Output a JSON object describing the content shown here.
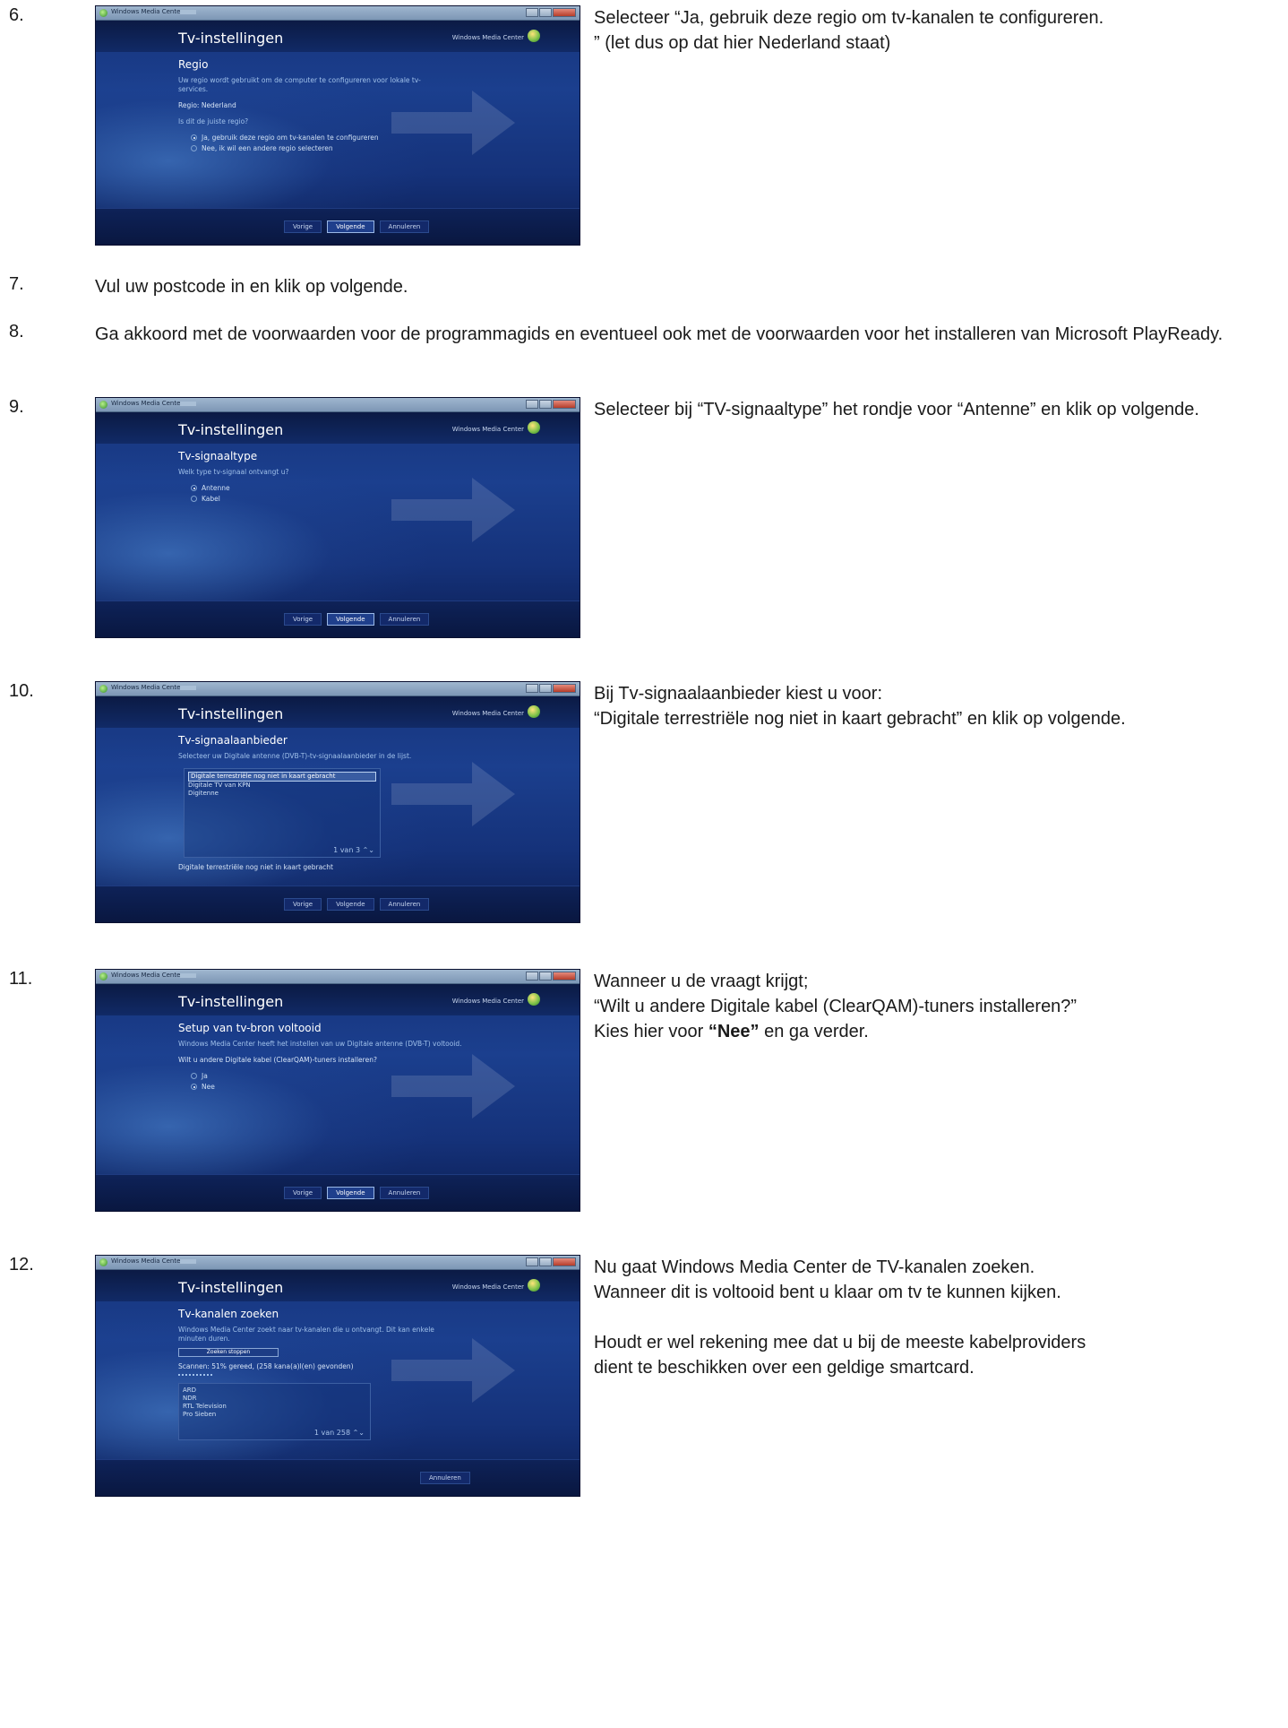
{
  "window_common": {
    "app_title": "Windows Media Center",
    "header_title": "Tv-instellingen",
    "brand": "Windows Media Center",
    "buttons": {
      "prev": "Vorige",
      "next": "Volgende",
      "cancel": "Annuleren"
    }
  },
  "steps": [
    {
      "num": "6.",
      "screen": {
        "heading": "Regio",
        "intro": "Uw regio wordt gebruikt om de computer te configureren voor lokale tv-services.",
        "region": "Regio: Nederland",
        "question": "Is dit de juiste regio?",
        "options": [
          "Ja, gebruik deze regio om tv-kanalen te configureren",
          "Nee, ik wil een andere regio selecteren"
        ]
      },
      "text": [
        "Selecteer “Ja, gebruik deze regio om tv-kanalen te configureren.",
        "” (let dus op dat hier Nederland staat)"
      ]
    },
    {
      "num": "7.",
      "text": "Vul uw postcode in en klik op volgende."
    },
    {
      "num": "8.",
      "text": "Ga akkoord met de voorwaarden voor de programmagids en eventueel ook met de voorwaarden voor het installeren van Microsoft PlayReady."
    },
    {
      "num": "9.",
      "screen": {
        "heading": "Tv-signaaltype",
        "question": "Welk type tv-signaal ontvangt u?",
        "options": [
          "Antenne",
          "Kabel"
        ]
      },
      "text": [
        "Selecteer bij “TV-signaaltype” het rondje voor “Antenne” en klik op volgende."
      ]
    },
    {
      "num": "10.",
      "screen": {
        "heading": "Tv-signaalaanbieder",
        "intro": "Selecteer uw Digitale antenne (DVB-T)-tv-signaalaanbieder in de lijst.",
        "list": [
          "Digitale terrestriële nog niet in kaart gebracht",
          "Digitale TV van KPN",
          "Digitenne"
        ],
        "pager": "1 van 3",
        "selected_label": "Digitale terrestriële nog niet in kaart gebracht"
      },
      "text": [
        "Bij Tv-signaalaanbieder kiest u voor:",
        "“Digitale terrestriële nog niet in kaart gebracht” en klik op volgende."
      ]
    },
    {
      "num": "11.",
      "screen": {
        "heading": "Setup van tv-bron voltooid",
        "intro": "Windows Media Center heeft het instellen van uw Digitale antenne (DVB-T) voltooid.",
        "question": "Wilt u andere Digitale kabel (ClearQAM)-tuners installeren?",
        "options": [
          "Ja",
          "Nee"
        ]
      },
      "text": {
        "line1": "Wanneer u de vraagt krijgt;",
        "line2": "“Wilt u andere Digitale kabel (ClearQAM)-tuners installeren?”",
        "line3_pre": "Kies hier voor ",
        "line3_bold": "“Nee”",
        "line3_post": " en ga verder."
      }
    },
    {
      "num": "12.",
      "screen": {
        "heading": "Tv-kanalen zoeken",
        "intro": "Windows Media Center zoekt naar tv-kanalen die u ontvangt. Dit kan enkele minuten duren.",
        "stop_button": "Zoeken stoppen",
        "status": "Scannen: 51% gereed, (258 kana(a)l(en) gevonden)",
        "list": [
          "ARD",
          "NDR",
          "RTL Television",
          "Pro Sieben"
        ],
        "pager": "1 van 258"
      },
      "text": [
        "Nu gaat Windows Media Center de TV-kanalen zoeken.",
        "Wanneer dit is voltooid bent u klaar om tv te kunnen kijken.",
        "",
        "Houdt er wel rekening mee dat u bij de meeste kabelproviders",
        "dient te beschikken over een geldige smartcard."
      ]
    }
  ]
}
